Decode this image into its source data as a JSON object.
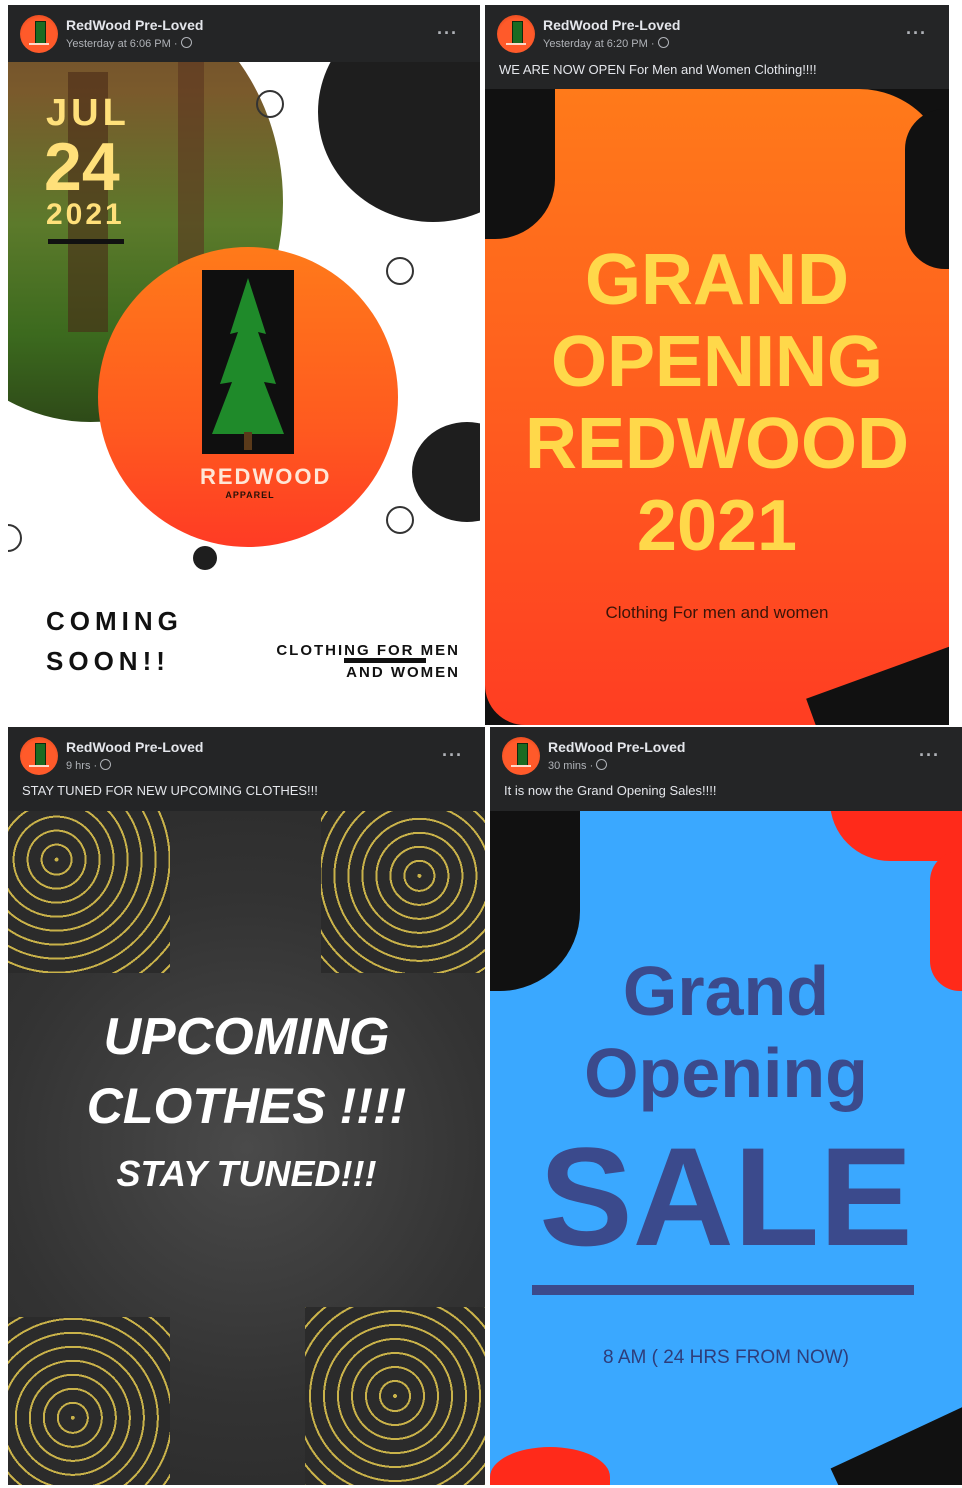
{
  "posts": [
    {
      "author": "RedWood Pre-Loved",
      "time": "Yesterday at 6:06 PM ·",
      "caption": "",
      "image": {
        "month": "JUL",
        "day": "24",
        "year": "2021",
        "brand": "REDWOOD",
        "brand_sub": "APPAREL",
        "coming": "COMING",
        "soon": "SOON!!",
        "clothing_line1": "CLOTHING FOR MEN",
        "clothing_line2": "AND WOMEN"
      }
    },
    {
      "author": "RedWood Pre-Loved",
      "time": "Yesterday at 6:20 PM ·",
      "caption": "WE ARE NOW OPEN For Men and Women Clothing!!!!",
      "image": {
        "line1": "GRAND",
        "line2": "OPENING",
        "line3": "REDWOOD",
        "line4": "2021",
        "sub": "Clothing For men and women"
      }
    },
    {
      "author": "RedWood Pre-Loved",
      "time": "9 hrs ·",
      "caption": "STAY TUNED FOR NEW UPCOMING CLOTHES!!!",
      "image": {
        "line1": "UPCOMING",
        "line2": "CLOTHES !!!!",
        "line3": "STAY TUNED!!!"
      }
    },
    {
      "author": "RedWood Pre-Loved",
      "time": "30 mins ·",
      "caption": "It is now the Grand Opening Sales!!!!",
      "image": {
        "line1": "Grand",
        "line2": "Opening",
        "line3": "SALE",
        "sub": "8 AM ( 24 HRS FROM NOW)"
      }
    }
  ],
  "more_icon": "more-horizontal-icon",
  "colors": {
    "card_bg": "#242526",
    "orange": "#ff6a1a",
    "red": "#ff3b1f",
    "yellow": "#ffd84a",
    "blue_bg": "#3aa8ff",
    "navy": "#3b4a8c"
  }
}
